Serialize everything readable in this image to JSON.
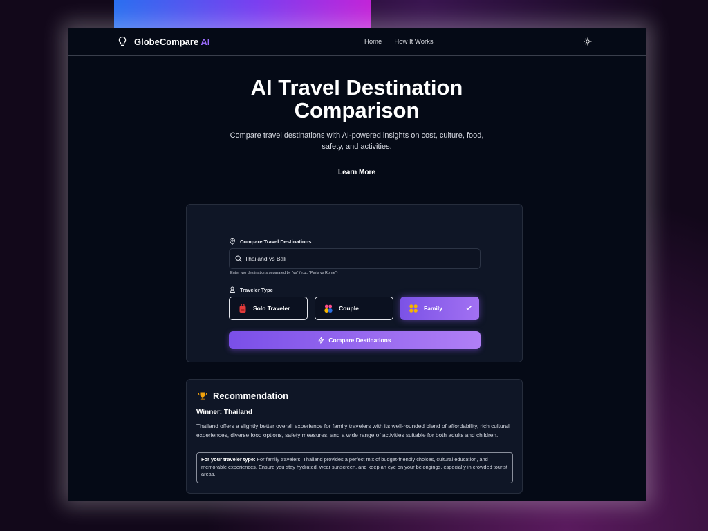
{
  "nav": {
    "brand_main": "GlobeCompare",
    "brand_ai": "AI",
    "links": [
      "Home",
      "How It Works"
    ]
  },
  "hero": {
    "title": "AI Travel Destination Comparison",
    "subtitle": "Compare travel destinations with AI-powered insights on cost, culture, food, safety, and activities.",
    "learn_more": "Learn More"
  },
  "form": {
    "destinations_label": "Compare Travel Destinations",
    "search_value": "Thailand vs Bali",
    "hint": "Enter two destinations separated by \"vs\" (e.g., \"Paris vs Rome\")",
    "traveler_label": "Traveler Type",
    "traveler_types": [
      {
        "label": "Solo Traveler",
        "icon": "backpack-icon",
        "selected": false
      },
      {
        "label": "Couple",
        "icon": "couple-icon",
        "selected": false
      },
      {
        "label": "Family",
        "icon": "family-icon",
        "selected": true
      }
    ],
    "compare_button": "Compare Destinations"
  },
  "recommendation": {
    "heading": "Recommendation",
    "winner": "Winner: Thailand",
    "body": "Thailand offers a slightly better overall experience for family travelers with its well-rounded blend of affordability, rich cultural experiences, diverse food options, safety measures, and a wide range of activities suitable for both adults and children.",
    "traveler_note_label": "For your traveler type:",
    "traveler_note": "For family travelers, Thailand provides a perfect mix of budget-friendly choices, cultural education, and memorable experiences. Ensure you stay hydrated, wear sunscreen, and keep an eye on your belongings, especially in crowded tourist areas."
  },
  "colors": {
    "accent": "#8b5cf6",
    "background": "#050a16",
    "card": "#0f1626"
  }
}
